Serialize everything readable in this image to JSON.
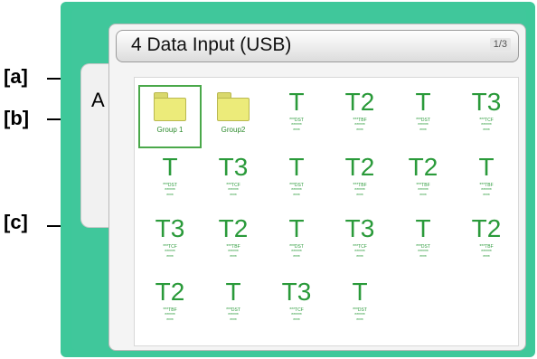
{
  "callouts": [
    "[a]",
    "[b]",
    "[c]"
  ],
  "window": {
    "title": "4 Data Input (USB)",
    "page_indicator": "1/3",
    "side_tab": "A"
  },
  "folders": [
    {
      "label": "Group 1"
    },
    {
      "label": "Group2"
    }
  ],
  "items": [
    {
      "code": "T",
      "sub": [
        "***DST",
        "******",
        "****"
      ]
    },
    {
      "code": "T2",
      "sub": [
        "***TBF",
        "******",
        "****"
      ]
    },
    {
      "code": "T",
      "sub": [
        "***DST",
        "******",
        "****"
      ]
    },
    {
      "code": "T3",
      "sub": [
        "***TCF",
        "******",
        "****"
      ]
    },
    {
      "code": "T",
      "sub": [
        "***DST",
        "******",
        "****"
      ]
    },
    {
      "code": "T3",
      "sub": [
        "***TCF",
        "******",
        "****"
      ]
    },
    {
      "code": "T",
      "sub": [
        "***DST",
        "******",
        "****"
      ]
    },
    {
      "code": "T2",
      "sub": [
        "***TBF",
        "******",
        "****"
      ]
    },
    {
      "code": "T2",
      "sub": [
        "***TBF",
        "******",
        "****"
      ]
    },
    {
      "code": "T",
      "sub": [
        "***TBF",
        "******",
        "****"
      ]
    },
    {
      "code": "T3",
      "sub": [
        "***TCF",
        "******",
        "****"
      ]
    },
    {
      "code": "T2",
      "sub": [
        "***TBF",
        "******",
        "****"
      ]
    },
    {
      "code": "T",
      "sub": [
        "***DST",
        "******",
        "****"
      ]
    },
    {
      "code": "T3",
      "sub": [
        "***TCF",
        "******",
        "****"
      ]
    },
    {
      "code": "T",
      "sub": [
        "***DST",
        "******",
        "****"
      ]
    },
    {
      "code": "T2",
      "sub": [
        "***TBF",
        "******",
        "****"
      ]
    },
    {
      "code": "T2",
      "sub": [
        "***TBF",
        "******",
        "****"
      ]
    },
    {
      "code": "T",
      "sub": [
        "***DST",
        "******",
        "****"
      ]
    },
    {
      "code": "T3",
      "sub": [
        "***TCF",
        "******",
        "****"
      ]
    },
    {
      "code": "T",
      "sub": [
        "***DST",
        "******",
        "****"
      ]
    }
  ]
}
